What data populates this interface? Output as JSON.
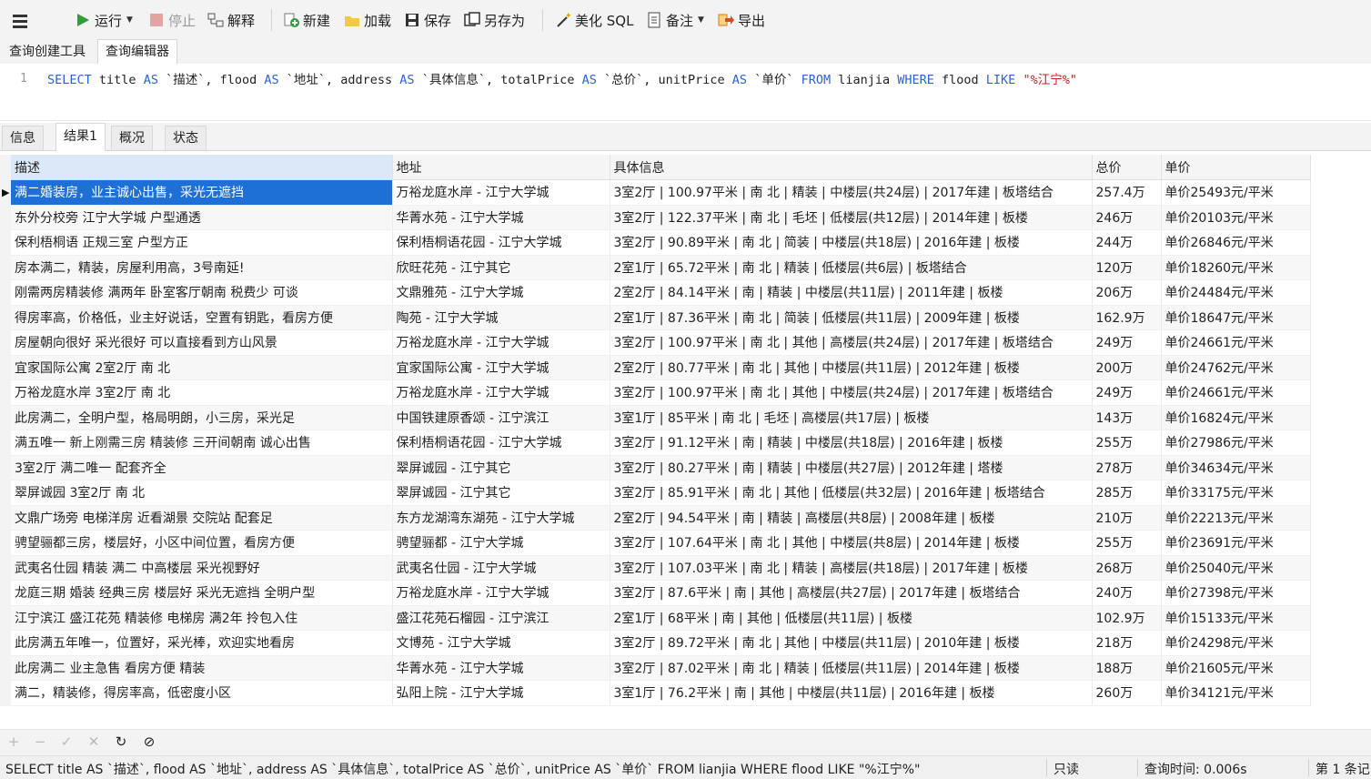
{
  "toolbar": {
    "run_label": "运行",
    "stop_label": "停止",
    "explain_label": "解释",
    "new_label": "新建",
    "load_label": "加载",
    "save_label": "保存",
    "save_as_label": "另存为",
    "beautify_label": "美化 SQL",
    "note_label": "备注",
    "export_label": "导出"
  },
  "editor_tabs": [
    {
      "label": "查询创建工具"
    },
    {
      "label": "查询编辑器"
    }
  ],
  "sql": {
    "line_number": "1",
    "tokens": [
      {
        "t": "SELECT",
        "kw": true
      },
      {
        "t": " title "
      },
      {
        "t": "AS",
        "kw": true
      },
      {
        "t": " `描述`, flood "
      },
      {
        "t": "AS",
        "kw": true
      },
      {
        "t": " `地址`, address "
      },
      {
        "t": "AS",
        "kw": true
      },
      {
        "t": " `具体信息`, totalPrice "
      },
      {
        "t": "AS",
        "kw": true
      },
      {
        "t": " `总价`, unitPrice "
      },
      {
        "t": "AS",
        "kw": true
      },
      {
        "t": " `单价` "
      },
      {
        "t": "FROM",
        "kw": true
      },
      {
        "t": " lianjia "
      },
      {
        "t": "WHERE",
        "kw": true
      },
      {
        "t": " flood "
      },
      {
        "t": "LIKE",
        "kw": true
      },
      {
        "t": " "
      },
      {
        "t": "\"%江宁%\"",
        "str": true
      }
    ]
  },
  "result_tabs": [
    {
      "label": "信息"
    },
    {
      "label": "结果1"
    },
    {
      "label": "概况"
    },
    {
      "label": "状态"
    }
  ],
  "table": {
    "columns": [
      "描述",
      "地址",
      "具体信息",
      "总价",
      "单价"
    ],
    "rows": [
      [
        "满二婚装房，业主诚心出售，采光无遮挡",
        "万裕龙庭水岸 - 江宁大学城",
        "3室2厅 | 100.97平米 | 南 北 | 精装 | 中楼层(共24层) | 2017年建 | 板塔结合",
        "257.4万",
        "单价25493元/平米"
      ],
      [
        "东外分校旁  江宁大学城 户型通透",
        "华菁水苑 - 江宁大学城",
        "3室2厅 | 122.37平米 | 南 北 | 毛坯 | 低楼层(共12层) | 2014年建 | 板楼",
        "246万",
        "单价20103元/平米"
      ],
      [
        "保利梧桐语 正规三室 户型方正",
        "保利梧桐语花园 - 江宁大学城",
        "3室2厅 | 90.89平米 | 南 北 | 简装 | 中楼层(共18层) | 2016年建 | 板楼",
        "244万",
        "单价26846元/平米"
      ],
      [
        "房本满二，精装，房屋利用高，3号南延!",
        "欣旺花苑 - 江宁其它",
        "2室1厅 | 65.72平米 | 南 北 | 精装 | 低楼层(共6层)  | 板塔结合",
        "120万",
        "单价18260元/平米"
      ],
      [
        "刚需两房精装修 满两年 卧室客厅朝南 税费少 可谈",
        "文鼎雅苑 - 江宁大学城",
        "2室2厅 | 84.14平米 | 南 | 精装 | 中楼层(共11层) | 2011年建 | 板楼",
        "206万",
        "单价24484元/平米"
      ],
      [
        "得房率高，价格低，业主好说话，空置有钥匙，看房方便",
        "陶苑 - 江宁大学城",
        "2室1厅 | 87.36平米 | 南 北 | 简装 | 低楼层(共11层) | 2009年建 | 板楼",
        "162.9万",
        "单价18647元/平米"
      ],
      [
        "房屋朝向很好 采光很好 可以直接看到方山风景",
        "万裕龙庭水岸 - 江宁大学城",
        "3室2厅 | 100.97平米 | 南 北 | 其他 | 高楼层(共24层) | 2017年建 | 板塔结合",
        "249万",
        "单价24661元/平米"
      ],
      [
        "宜家国际公寓 2室2厅 南 北",
        "宜家国际公寓 - 江宁大学城",
        "2室2厅 | 80.77平米 | 南 北 | 其他 | 中楼层(共11层) | 2012年建 | 板楼",
        "200万",
        "单价24762元/平米"
      ],
      [
        "万裕龙庭水岸 3室2厅 南 北",
        "万裕龙庭水岸 - 江宁大学城",
        "3室2厅 | 100.97平米 | 南 北 | 其他 | 中楼层(共24层) | 2017年建 | 板塔结合",
        "249万",
        "单价24661元/平米"
      ],
      [
        "此房满二，全明户型，格局明朗，小三房，采光足",
        "中国铁建原香颂 - 江宁滨江",
        "3室1厅 | 85平米 | 南 北 | 毛坯 | 高楼层(共17层)  | 板楼",
        "143万",
        "单价16824元/平米"
      ],
      [
        "满五唯一 新上刚需三房 精装修 三开间朝南 诚心出售",
        "保利梧桐语花园 - 江宁大学城",
        "3室2厅 | 91.12平米 | 南 | 精装 | 中楼层(共18层) | 2016年建 | 板楼",
        "255万",
        "单价27986元/平米"
      ],
      [
        "3室2厅  满二唯一  配套齐全",
        "翠屏诚园 - 江宁其它",
        "3室2厅 | 80.27平米 | 南 | 精装 | 中楼层(共27层) | 2012年建 | 塔楼",
        "278万",
        "单价34634元/平米"
      ],
      [
        "翠屏诚园 3室2厅 南 北",
        "翠屏诚园 - 江宁其它",
        "3室2厅 | 85.91平米 | 南 北 | 其他 | 低楼层(共32层) | 2016年建 | 板塔结合",
        "285万",
        "单价33175元/平米"
      ],
      [
        "文鼎广场旁 电梯洋房 近看湖景 交院站 配套足",
        "东方龙湖湾东湖苑 - 江宁大学城",
        "2室2厅 | 94.54平米 | 南 | 精装 | 高楼层(共8层) | 2008年建 | 板楼",
        "210万",
        "单价22213元/平米"
      ],
      [
        "骋望骊都三房，楼层好，小区中间位置，看房方便",
        "骋望骊都 - 江宁大学城",
        "3室2厅 | 107.64平米 | 南 北 | 其他 | 中楼层(共8层) | 2014年建 | 板楼",
        "255万",
        "单价23691元/平米"
      ],
      [
        "武夷名仕园  精装 满二 中高楼层  采光视野好",
        "武夷名仕园 - 江宁大学城",
        "3室2厅 | 107.03平米 | 南 北 | 精装 | 高楼层(共18层) | 2017年建 | 板楼",
        "268万",
        "单价25040元/平米"
      ],
      [
        "龙庭三期 婚装 经典三房 楼层好 采光无遮挡 全明户型",
        "万裕龙庭水岸 - 江宁大学城",
        "3室2厅 | 87.6平米 | 南 | 其他 | 高楼层(共27层) | 2017年建 | 板塔结合",
        "240万",
        "单价27398元/平米"
      ],
      [
        "江宁滨江 盛江花苑 精装修 电梯房 满2年 拎包入住",
        "盛江花苑石榴园 - 江宁滨江",
        "2室1厅 | 68平米 | 南 | 其他 | 低楼层(共11层)  | 板楼",
        "102.9万",
        "单价15133元/平米"
      ],
      [
        "此房满五年唯一，位置好，采光棒，欢迎实地看房",
        "文博苑 - 江宁大学城",
        "3室2厅 | 89.72平米 | 南 北 | 其他 | 中楼层(共11层) | 2010年建 | 板楼",
        "218万",
        "单价24298元/平米"
      ],
      [
        "此房满二 业主急售 看房方便 精装",
        "华菁水苑 - 江宁大学城",
        "3室2厅 | 87.02平米 | 南 北 | 精装 | 低楼层(共11层) | 2014年建 | 板楼",
        "188万",
        "单价21605元/平米"
      ],
      [
        "满二，精装修，得房率高，低密度小区",
        "弘阳上院 - 江宁大学城",
        "3室1厅 | 76.2平米 | 南 | 其他 | 中楼层(共11层) | 2016年建 | 板楼",
        "260万",
        "单价34121元/平米"
      ]
    ]
  },
  "status": {
    "sql_text": "SELECT title AS `描述`, flood AS `地址`, address AS `具体信息`, totalPrice AS `总价`, unitPrice AS `单价` FROM lianjia WHERE flood LIKE \"%江宁%\"",
    "mode": "只读",
    "query_time": "查询时间: 0.006s",
    "record": "第 1 条记"
  },
  "colors": {
    "selection": "#1e6fd6",
    "keyword": "#2a63d8",
    "string": "#c9211e",
    "run_green": "#2e9e3a"
  }
}
